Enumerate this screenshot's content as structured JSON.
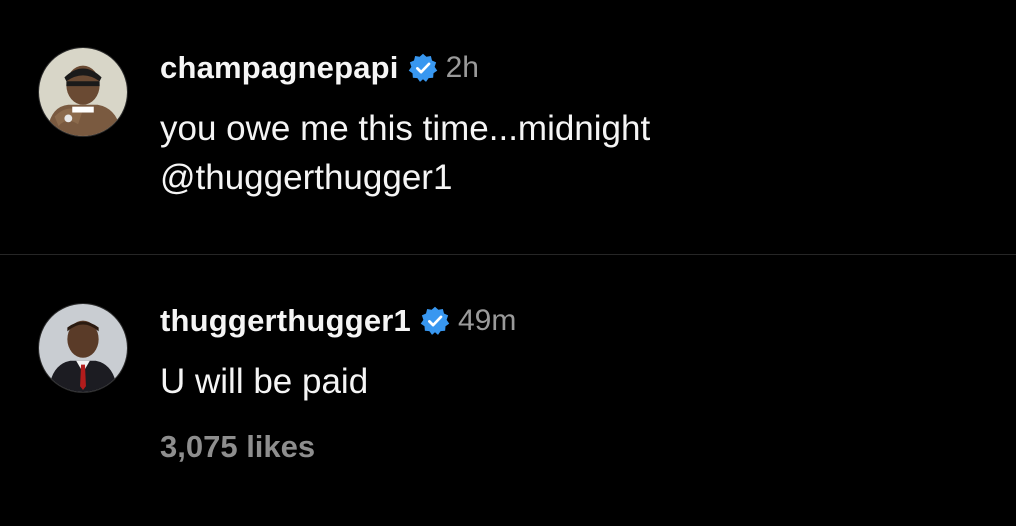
{
  "comments": [
    {
      "username": "champagnepapi",
      "verified": true,
      "timestamp": "2h",
      "text_line1": "you owe me this time...midnight",
      "mention": "@thuggerthugger1",
      "avatar_icon": "profile-photo-man-in-bandana"
    },
    {
      "username": "thuggerthugger1",
      "verified": true,
      "timestamp": "49m",
      "text_line1": "U will be paid",
      "likes": "3,075 likes",
      "avatar_icon": "profile-photo-boy-in-suit"
    }
  ],
  "colors": {
    "background": "#000000",
    "text": "#f5f5f5",
    "muted": "#9a9a9a",
    "verified_badge": "#3897f0",
    "divider": "#262626"
  }
}
